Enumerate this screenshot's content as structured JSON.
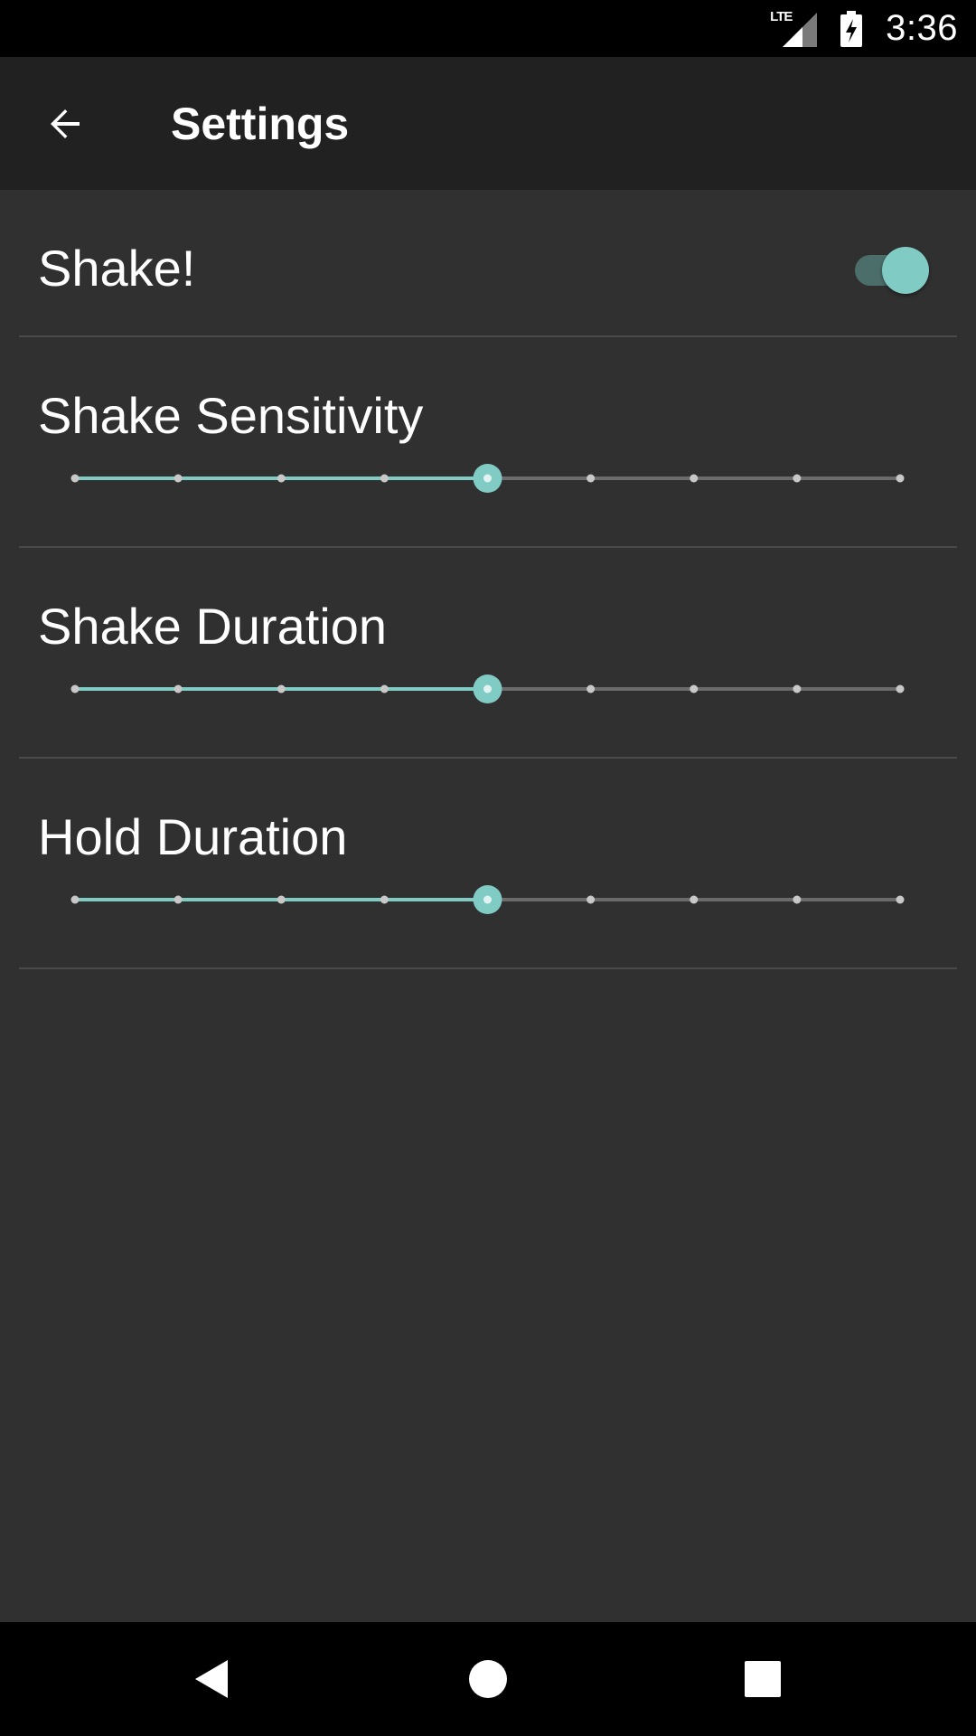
{
  "status_bar": {
    "time": "3:36",
    "network_label": "LTE",
    "icons": [
      "lte-signal-icon",
      "battery-charging-icon"
    ]
  },
  "app_bar": {
    "title": "Settings",
    "back_icon": "arrow-back-icon"
  },
  "preferences": [
    {
      "type": "switch",
      "title": "Shake!",
      "checked": true
    },
    {
      "type": "slider",
      "title": "Shake Sensitivity",
      "steps": 9,
      "value_index": 4
    },
    {
      "type": "slider",
      "title": "Shake Duration",
      "steps": 9,
      "value_index": 4
    },
    {
      "type": "slider",
      "title": "Hold Duration",
      "steps": 9,
      "value_index": 4
    }
  ],
  "nav_bar": {
    "icons": [
      "nav-back-icon",
      "nav-home-icon",
      "nav-recents-icon"
    ]
  },
  "colors": {
    "accent": "#80cbc4",
    "background": "#303030",
    "app_bar": "#212121",
    "track_inactive": "#6b6b6b",
    "tick": "#c8c8c8"
  }
}
